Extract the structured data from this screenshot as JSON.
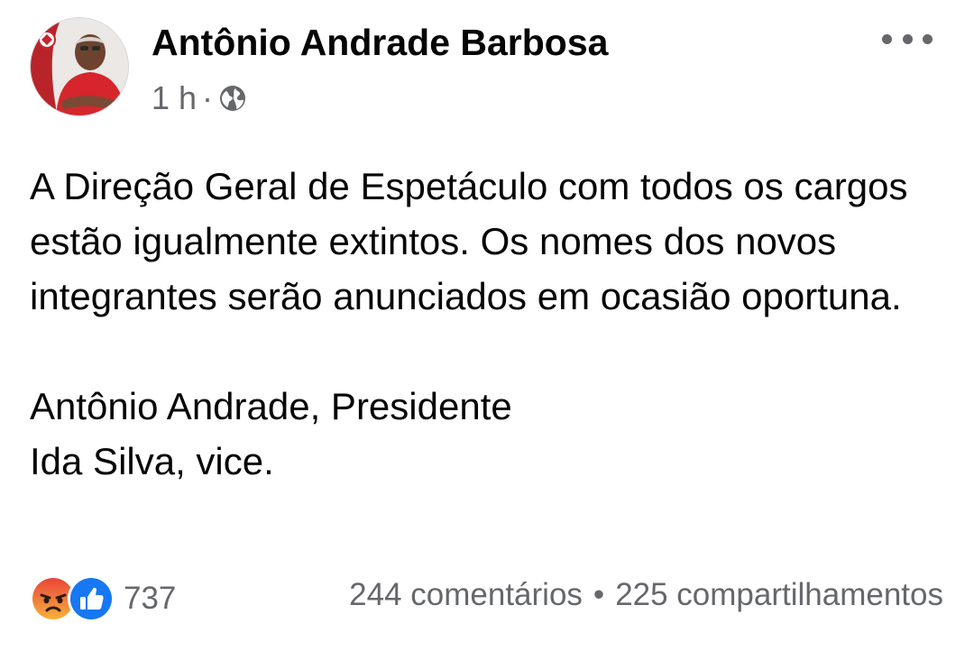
{
  "post": {
    "author": "Antônio Andrade Barbosa",
    "time": "1 h",
    "separator": "·",
    "privacy_icon": "globe-icon",
    "more_icon": "more-options-icon",
    "body": [
      "A Direção Geral de Espetáculo com todos os cargos estão igualmente extintos. Os nomes dos novos integrantes serão anunciados em ocasião oportuna.",
      "Antônio Andrade, Presidente",
      "Ida Silva, vice."
    ],
    "reactions": {
      "icons": [
        "angry-reaction-icon",
        "like-reaction-icon"
      ],
      "count": "737"
    },
    "comments": "244 comentários",
    "dot": "•",
    "shares": "225 compartilhamentos"
  },
  "colors": {
    "text": "#050505",
    "secondary": "#65676b",
    "like_blue": "#1877f2",
    "angry_orange": "#f0792a",
    "avatar_red": "#d42a2a"
  }
}
